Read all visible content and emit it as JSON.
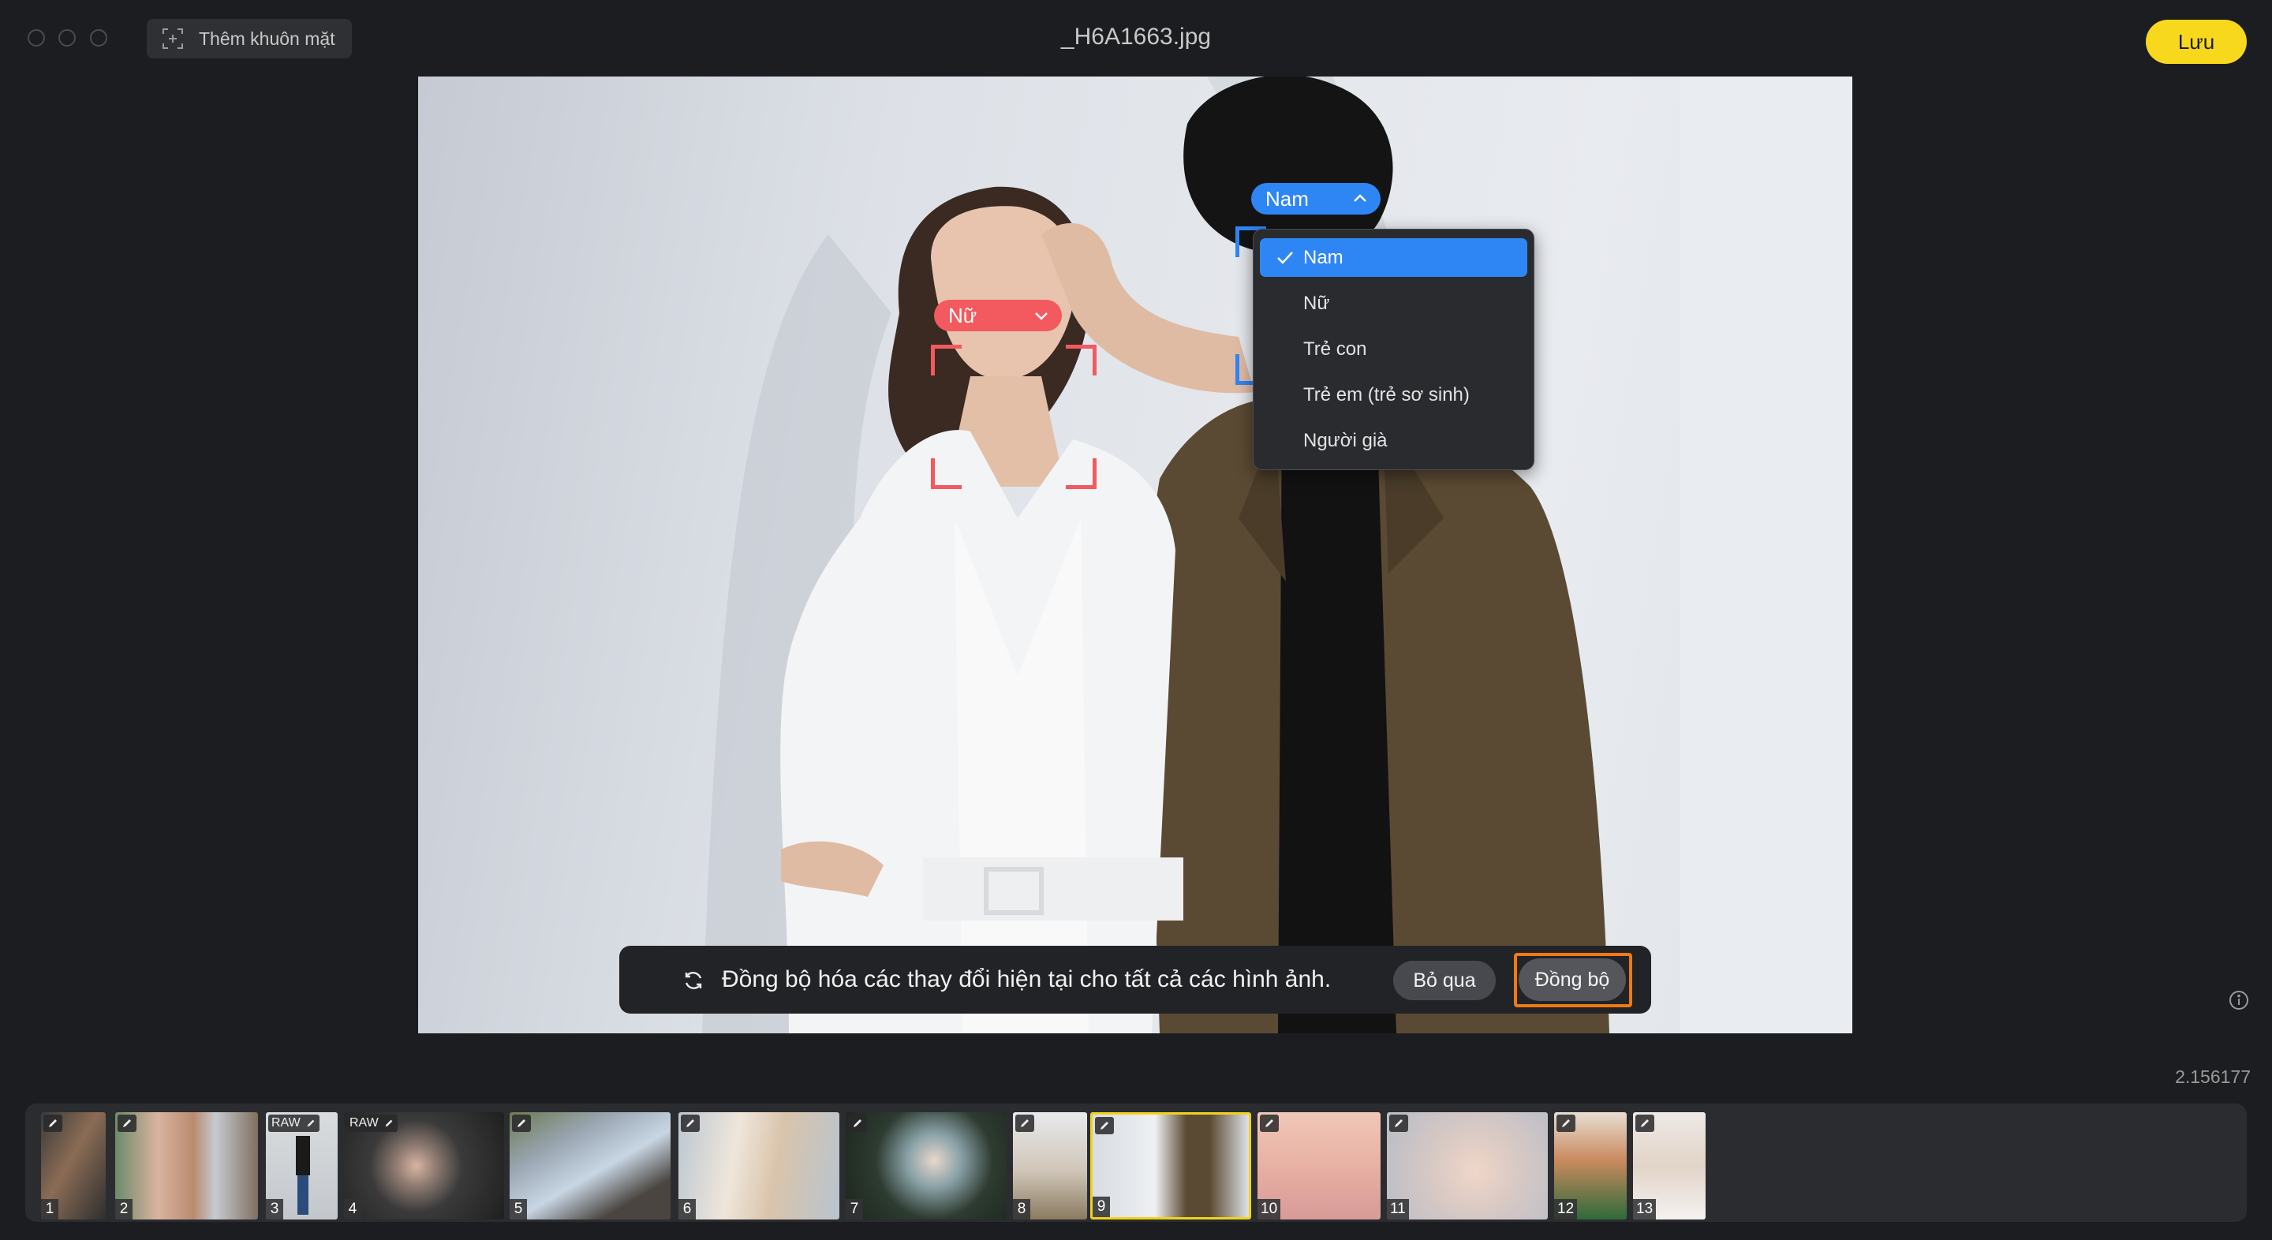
{
  "window": {
    "title": "_H6A1663.jpg",
    "add_face_label": "Thêm khuôn mặt",
    "save_label": "Lưu"
  },
  "faces": [
    {
      "label": "Nữ",
      "color": "#f25a5f",
      "expanded": false
    },
    {
      "label": "Nam",
      "color": "#2e86f5",
      "expanded": true
    }
  ],
  "dropdown": {
    "options": [
      "Nam",
      "Nữ",
      "Trẻ con",
      "Trẻ em (trẻ sơ sinh)",
      "Người già"
    ],
    "selected": "Nam"
  },
  "sync_bar": {
    "message": "Đồng bộ hóa các thay đổi hiện tại cho tất cả các hình ảnh.",
    "skip_label": "Bỏ qua",
    "sync_label": "Đồng bộ"
  },
  "version": "2.156177",
  "filmstrip": {
    "raw_label": "RAW",
    "thumbs": [
      {
        "num": "1",
        "raw": false
      },
      {
        "num": "2",
        "raw": false
      },
      {
        "num": "3",
        "raw": true
      },
      {
        "num": "4",
        "raw": true
      },
      {
        "num": "5",
        "raw": false
      },
      {
        "num": "6",
        "raw": false
      },
      {
        "num": "7",
        "raw": false
      },
      {
        "num": "8",
        "raw": false
      },
      {
        "num": "9",
        "raw": false,
        "selected": true
      },
      {
        "num": "10",
        "raw": false
      },
      {
        "num": "11",
        "raw": false
      },
      {
        "num": "12",
        "raw": false
      },
      {
        "num": "13",
        "raw": false
      }
    ]
  },
  "colors": {
    "accent_yellow": "#f8d81c",
    "accent_blue": "#2e86f5",
    "face_red": "#f25a5f",
    "highlight_orange": "#f07a10"
  }
}
